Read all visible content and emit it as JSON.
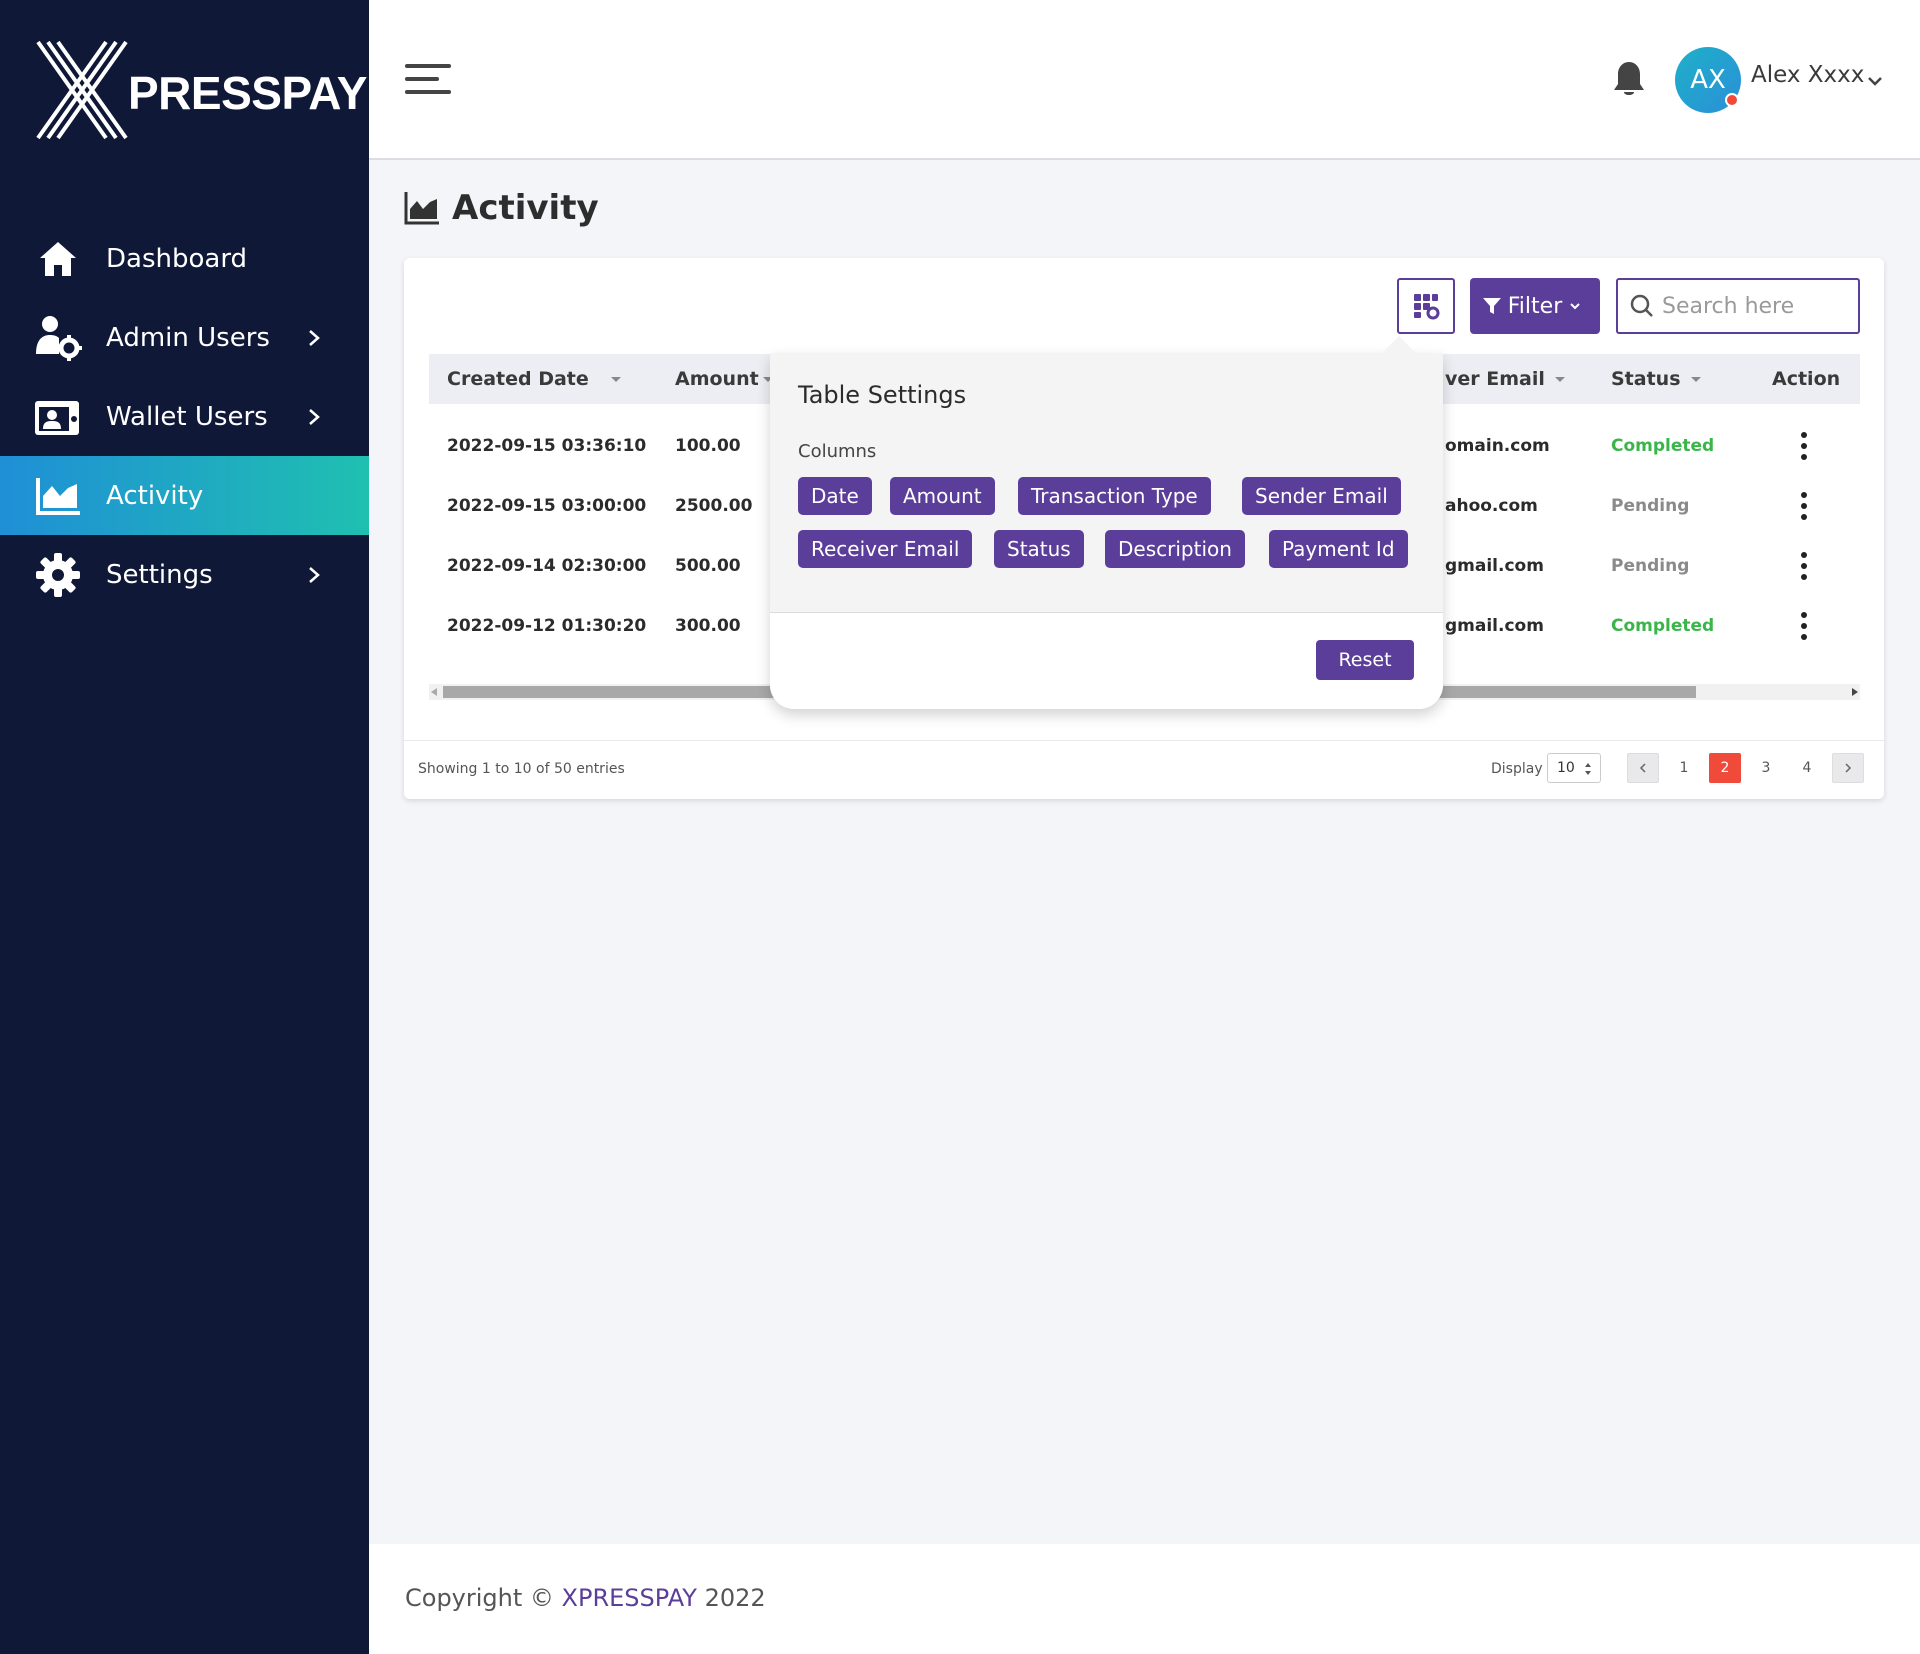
{
  "brand": {
    "logo_text": "PRESSPAY"
  },
  "sidebar": {
    "items": [
      {
        "label": "Dashboard",
        "icon": "home-icon",
        "has_chevron": false,
        "active": false
      },
      {
        "label": "Admin Users",
        "icon": "admin-users-icon",
        "has_chevron": true,
        "active": false
      },
      {
        "label": "Wallet Users",
        "icon": "wallet-users-icon",
        "has_chevron": true,
        "active": false
      },
      {
        "label": "Activity",
        "icon": "activity-chart-icon",
        "has_chevron": false,
        "active": true
      },
      {
        "label": "Settings",
        "icon": "gear-icon",
        "has_chevron": true,
        "active": false
      }
    ]
  },
  "header": {
    "avatar_initials": "AX",
    "user_name": "Alex Xxxx"
  },
  "page": {
    "title": "Activity"
  },
  "toolbar": {
    "filter_label": "Filter",
    "search_placeholder": "Search here"
  },
  "table": {
    "columns": [
      "Created Date",
      "Amount",
      "ver Email",
      "Status",
      "Action"
    ],
    "rows": [
      {
        "date": "2022-09-15 03:36:10",
        "amount": "100.00",
        "email": "omain.com",
        "status": "Completed"
      },
      {
        "date": "2022-09-15 03:00:00",
        "amount": "2500.00",
        "email": "ahoo.com",
        "status": "Pending"
      },
      {
        "date": "2022-09-14 02:30:00",
        "amount": "500.00",
        "email": "gmail.com",
        "status": "Pending"
      },
      {
        "date": "2022-09-12 01:30:20",
        "amount": "300.00",
        "email": "gmail.com",
        "status": "Completed"
      }
    ],
    "entries_text": "Showing 1 to 10 of 50 entries",
    "display_label": "Display",
    "display_value": "10",
    "pages": [
      "1",
      "2",
      "3",
      "4"
    ],
    "current_page": "2",
    "status_colors": {
      "Completed": "#3ab54a",
      "Pending": "#8a8a8a"
    }
  },
  "table_settings": {
    "title": "Table Settings",
    "subtitle": "Columns",
    "chips": [
      "Date",
      "Amount",
      "Transaction Type",
      "Sender Email",
      "Receiver Email",
      "Status",
      "Description",
      "Payment Id"
    ],
    "reset_label": "Reset"
  },
  "footer": {
    "prefix": "Copyright ©",
    "brand": "XPRESSPAY",
    "year": "2022"
  },
  "colors": {
    "sidebar_bg": "#101838",
    "accent": "#5b3e99",
    "active_gradient_start": "#1f8fd6",
    "active_gradient_end": "#1fc0b0",
    "page_active": "#f04a3a"
  }
}
